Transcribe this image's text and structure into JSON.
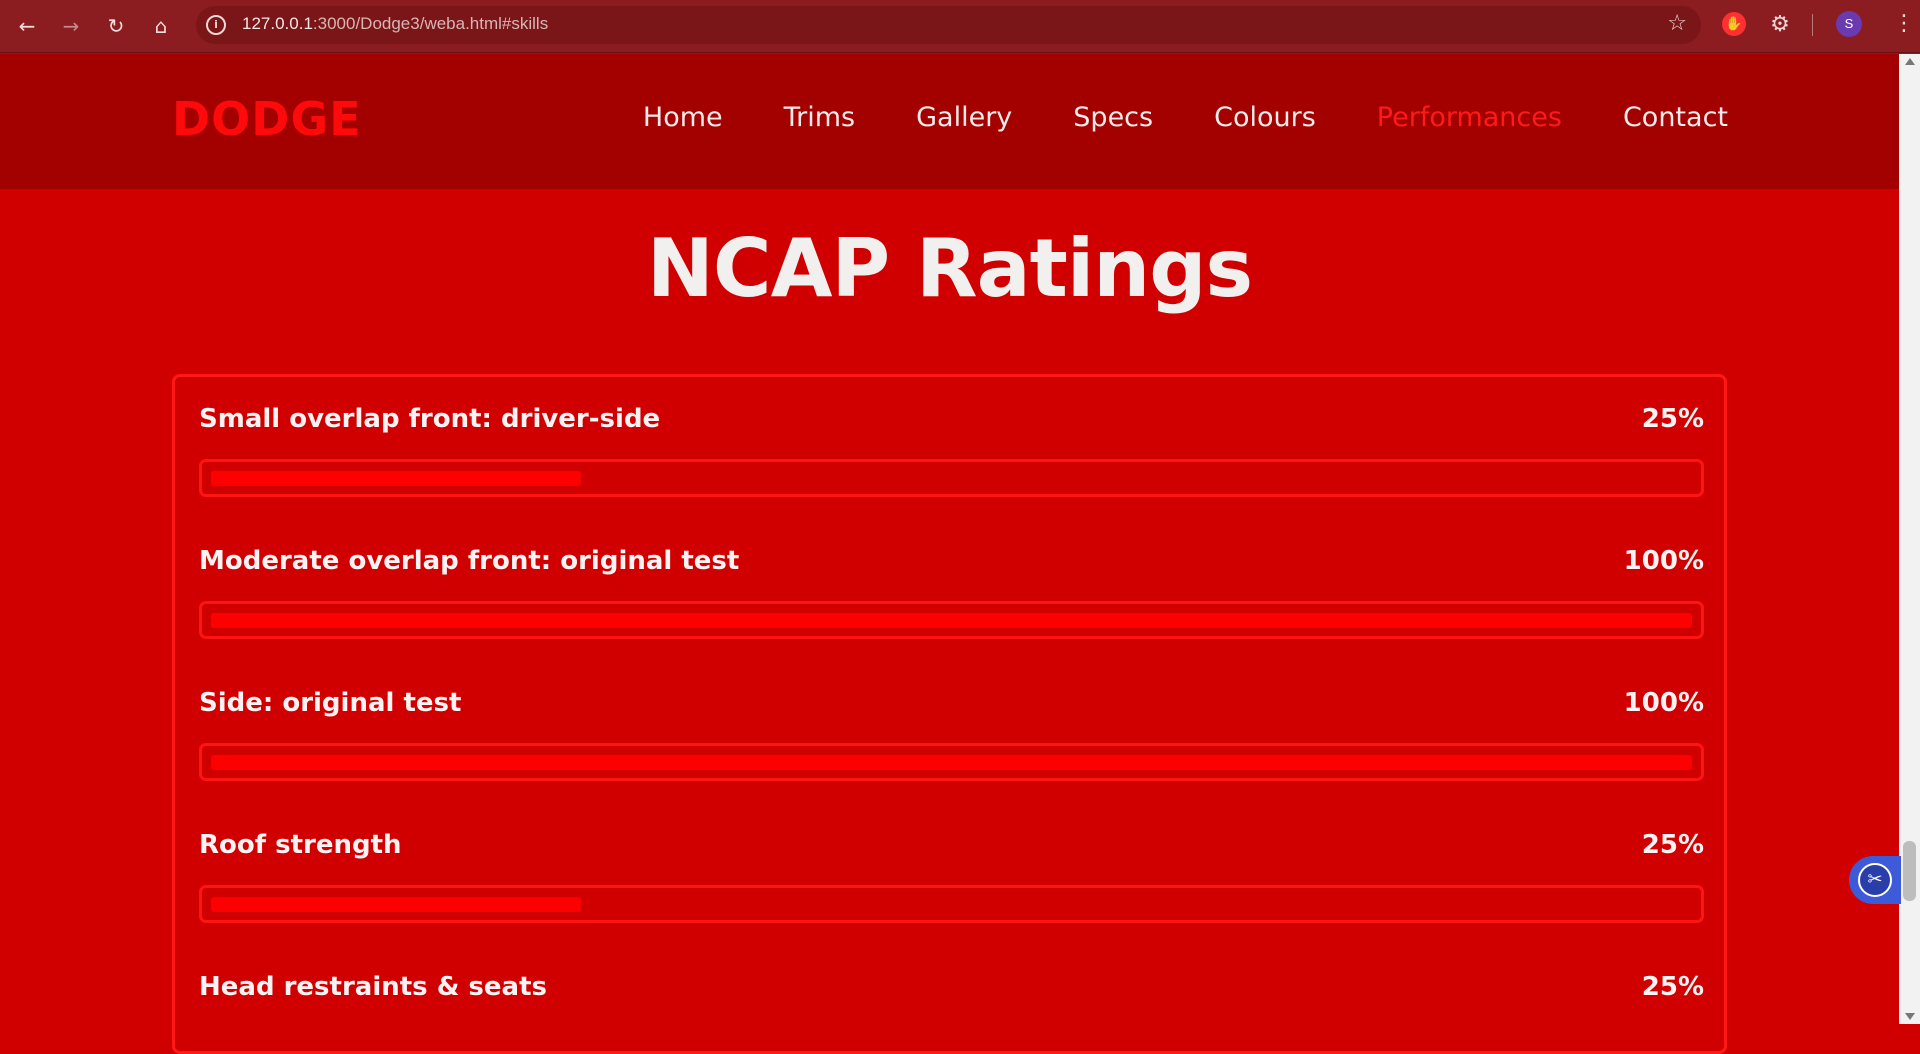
{
  "browser": {
    "url_host": "127.0.0.1",
    "url_rest": ":3000/Dodge3/weba.html#skills",
    "profile_initial": "S"
  },
  "header": {
    "logo": "DODGE",
    "nav": [
      {
        "label": "Home",
        "active": false
      },
      {
        "label": "Trims",
        "active": false
      },
      {
        "label": "Gallery",
        "active": false
      },
      {
        "label": "Specs",
        "active": false
      },
      {
        "label": "Colours",
        "active": false
      },
      {
        "label": "Performances",
        "active": true
      },
      {
        "label": "Contact",
        "active": false
      }
    ]
  },
  "section": {
    "title": "NCAP Ratings",
    "ratings": [
      {
        "label": "Small overlap front: driver-side",
        "value_text": "25%",
        "fraction": 0.25
      },
      {
        "label": "Moderate overlap front: original test",
        "value_text": "100%",
        "fraction": 1.0
      },
      {
        "label": "Side: original test",
        "value_text": "100%",
        "fraction": 1.0
      },
      {
        "label": "Roof strength",
        "value_text": "25%",
        "fraction": 0.25
      },
      {
        "label": "Head restraints & seats",
        "value_text": "25%",
        "fraction": 0.25
      }
    ]
  },
  "colors": {
    "page_background": "#d10000",
    "header_background": "#a30000",
    "accent": "#ff0000",
    "browser_chrome": "#8b1c1f"
  },
  "icons": {
    "back": "arrow-left-icon",
    "forward": "arrow-right-icon",
    "reload": "reload-icon",
    "home": "home-icon",
    "site_info": "info-icon",
    "bookmark": "star-icon",
    "extension": "stop-hand-icon",
    "extensions_menu": "puzzle-icon",
    "menu": "kebab-menu-icon",
    "floating_tool": "scissors-icon"
  }
}
